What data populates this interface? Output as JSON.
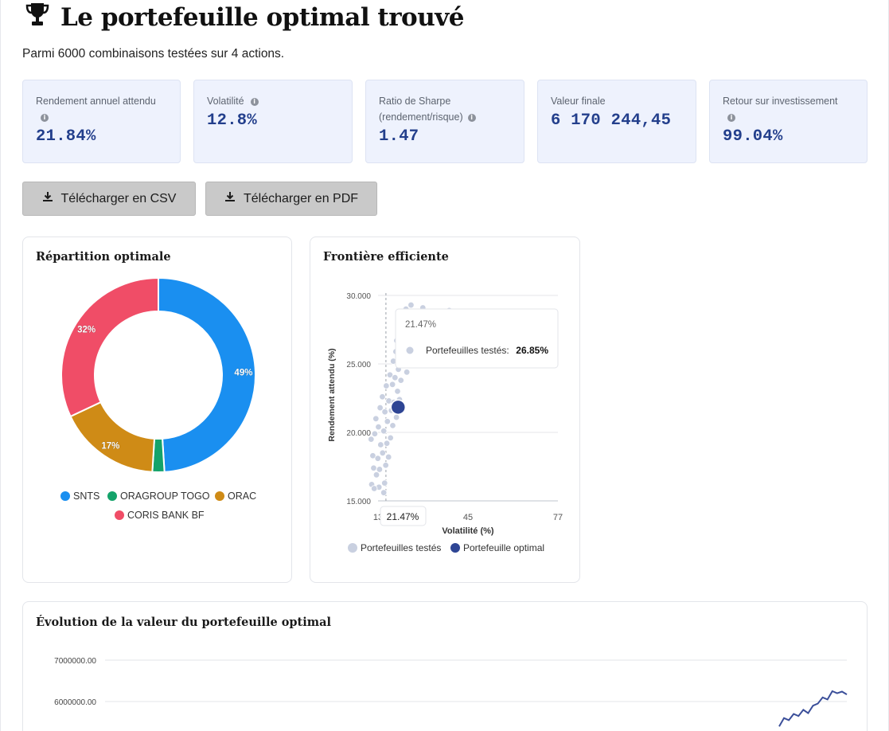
{
  "header": {
    "title": "Le portefeuille optimal trouvé",
    "subtitle": "Parmi 6000 combinaisons testées sur 4 actions."
  },
  "metrics": [
    {
      "label": "Rendement annuel attendu",
      "value": "21.84%"
    },
    {
      "label": "Volatilité",
      "value": "12.8%"
    },
    {
      "label": "Ratio de Sharpe (rendement/risque)",
      "value": "1.47"
    },
    {
      "label": "Valeur finale",
      "value": "6 170 244,45"
    },
    {
      "label": "Retour sur investissement",
      "value": "99.04%"
    }
  ],
  "buttons": {
    "csv": "Télécharger en CSV",
    "pdf": "Télécharger en PDF"
  },
  "donut": {
    "title": "Répartition optimale",
    "chart_data": {
      "type": "pie",
      "categories": [
        "SNTS",
        "ORAGROUP TOGO",
        "ORAC",
        "CORIS BANK BF"
      ],
      "values": [
        49,
        2,
        17,
        32
      ],
      "data_labels": [
        "49%",
        "",
        "17%",
        "32%"
      ],
      "colors": [
        "#1a8ff0",
        "#14a36a",
        "#cf8b16",
        "#f04d67"
      ],
      "legend_position": "bottom"
    }
  },
  "frontier": {
    "title": "Frontière efficiente",
    "tooltip": {
      "header": "21.47%",
      "series_label": "Portefeuilles testés:",
      "value": "26.85%"
    },
    "crosshair_x_label": "21.47%",
    "legend": [
      "Portefeuilles testés",
      "Portefeuille optimal"
    ],
    "chart_data": {
      "type": "scatter",
      "xlabel": "Volatilité (%)",
      "ylabel": "Rendement attendu (%)",
      "xlim": [
        13,
        77
      ],
      "ylim": [
        15,
        30
      ],
      "x_ticks": [
        "13",
        "45",
        "77"
      ],
      "y_ticks": [
        "15.000",
        "20.000",
        "25.000",
        "30.000"
      ],
      "series": [
        {
          "name": "Portefeuilles testés",
          "color": "#c9d0e0",
          "points": [
            [
              16.4,
              16.2
            ],
            [
              17.1,
              17.4
            ],
            [
              16.8,
              18.3
            ],
            [
              16.2,
              19.5
            ],
            [
              17.5,
              19.9
            ],
            [
              18.1,
              16.9
            ],
            [
              18.6,
              18.1
            ],
            [
              19.2,
              17.3
            ],
            [
              17.9,
              21.0
            ],
            [
              18.8,
              20.4
            ],
            [
              19.6,
              19.1
            ],
            [
              20.3,
              18.5
            ],
            [
              21.0,
              16.3
            ],
            [
              20.7,
              20.1
            ],
            [
              21.8,
              19.2
            ],
            [
              22.4,
              18.2
            ],
            [
              19.4,
              21.8
            ],
            [
              20.2,
              22.6
            ],
            [
              21.1,
              21.5
            ],
            [
              22.0,
              20.8
            ],
            [
              23.1,
              19.6
            ],
            [
              23.9,
              20.5
            ],
            [
              21.6,
              23.4
            ],
            [
              22.5,
              22.3
            ],
            [
              23.4,
              21.6
            ],
            [
              24.3,
              22.2
            ],
            [
              25.2,
              21.1
            ],
            [
              22.9,
              24.2
            ],
            [
              23.8,
              23.5
            ],
            [
              24.7,
              24.0
            ],
            [
              25.6,
              23.0
            ],
            [
              26.3,
              22.4
            ],
            [
              24.1,
              25.2
            ],
            [
              25.0,
              25.9
            ],
            [
              25.9,
              24.6
            ],
            [
              26.8,
              23.8
            ],
            [
              27.7,
              24.9
            ],
            [
              25.3,
              26.7
            ],
            [
              26.2,
              27.3
            ],
            [
              27.1,
              26.1
            ],
            [
              28.0,
              25.5
            ],
            [
              28.9,
              24.4
            ],
            [
              29.8,
              25.7
            ],
            [
              27.4,
              27.6
            ],
            [
              28.3,
              28.1
            ],
            [
              29.2,
              27.0
            ],
            [
              30.1,
              26.4
            ],
            [
              31.0,
              25.9
            ],
            [
              31.9,
              26.8
            ],
            [
              28.6,
              29.0
            ],
            [
              29.5,
              28.6
            ],
            [
              30.4,
              29.3
            ],
            [
              31.3,
              28.0
            ],
            [
              32.2,
              27.4
            ],
            [
              33.1,
              26.6
            ],
            [
              34.0,
              27.2
            ],
            [
              33.5,
              28.5
            ],
            [
              34.8,
              26.2
            ],
            [
              35.7,
              27.6
            ],
            [
              36.6,
              26.9
            ],
            [
              37.5,
              27.8
            ],
            [
              38.4,
              26.5
            ],
            [
              39.3,
              27.3
            ],
            [
              40.2,
              26.1
            ],
            [
              41.1,
              27.0
            ],
            [
              42.0,
              26.8
            ],
            [
              43.5,
              27.5
            ],
            [
              44.4,
              26.4
            ],
            [
              45.3,
              27.1
            ],
            [
              46.2,
              26.6
            ],
            [
              47.1,
              27.4
            ],
            [
              48.0,
              26.9
            ],
            [
              49.5,
              27.7
            ],
            [
              50.4,
              26.7
            ],
            [
              51.3,
              27.2
            ],
            [
              52.2,
              26.5
            ],
            [
              53.1,
              27.9
            ],
            [
              54.0,
              27.1
            ],
            [
              55.2,
              26.8
            ],
            [
              56.4,
              27.6
            ],
            [
              57.6,
              26.9
            ],
            [
              58.8,
              27.8
            ],
            [
              60.0,
              27.2
            ],
            [
              61.5,
              27.5
            ],
            [
              66.0,
              27.9
            ],
            [
              71.0,
              28.1
            ],
            [
              76.0,
              27.3
            ],
            [
              34.6,
              29.1
            ],
            [
              36.2,
              28.8
            ],
            [
              38.0,
              28.4
            ],
            [
              41.5,
              28.6
            ],
            [
              44.0,
              28.9
            ],
            [
              47.5,
              28.3
            ],
            [
              51.0,
              28.5
            ],
            [
              55.0,
              28.2
            ],
            [
              60.5,
              28.6
            ],
            [
              20.7,
              15.6
            ],
            [
              19.0,
              16.0
            ],
            [
              21.4,
              17.6
            ],
            [
              17.3,
              15.9
            ]
          ]
        },
        {
          "name": "Portefeuille optimal",
          "color": "#2e4594",
          "points": [
            [
              12.8,
              21.84
            ]
          ]
        }
      ]
    }
  },
  "evolution": {
    "title": "Évolution de la valeur du portefeuille optimal",
    "chart_data": {
      "type": "line",
      "y_ticks": [
        "6000000.00",
        "7000000.00"
      ],
      "series": [
        {
          "name": "",
          "color": "#3b4f9a",
          "values": [
            5400000,
            5600000,
            5550000,
            5700000,
            5650000,
            5800000,
            5720000,
            5900000,
            5950000,
            6100000,
            6050000,
            6250000,
            6200000,
            6240000,
            6170000
          ]
        }
      ]
    }
  }
}
